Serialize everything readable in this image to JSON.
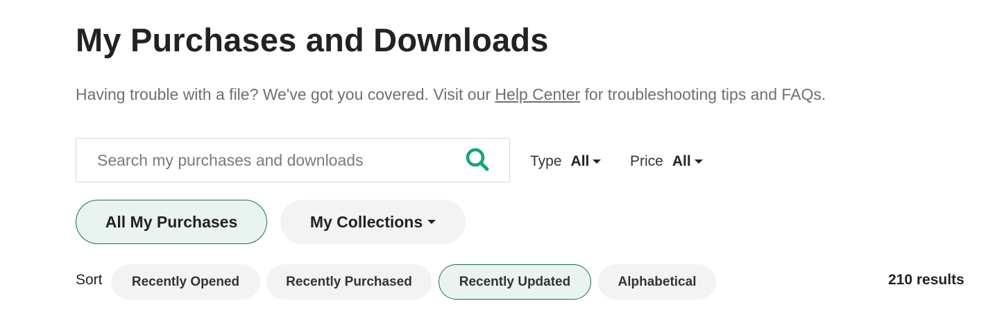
{
  "header": {
    "title": "My Purchases and Downloads"
  },
  "help": {
    "before": "Having trouble with a file? We've got you covered. Visit our ",
    "link": "Help Center",
    "after": " for troubleshooting tips and FAQs."
  },
  "search": {
    "placeholder": "Search my purchases and downloads",
    "value": "",
    "icon": "search-icon"
  },
  "filters": {
    "type": {
      "label": "Type",
      "value": "All"
    },
    "price": {
      "label": "Price",
      "value": "All"
    }
  },
  "view_tabs": {
    "all": {
      "label": "All My Purchases",
      "active": true
    },
    "collections": {
      "label": "My Collections",
      "active": false
    }
  },
  "sort": {
    "label": "Sort",
    "options": [
      "Recently Opened",
      "Recently Purchased",
      "Recently Updated",
      "Alphabetical"
    ],
    "selected": "Recently Updated"
  },
  "results": {
    "text": "210 results"
  },
  "colors": {
    "accent": "#14a37f",
    "active_border": "#1e6b52",
    "active_bg": "#e9f3ef",
    "pill_bg": "#f3f3f3"
  }
}
